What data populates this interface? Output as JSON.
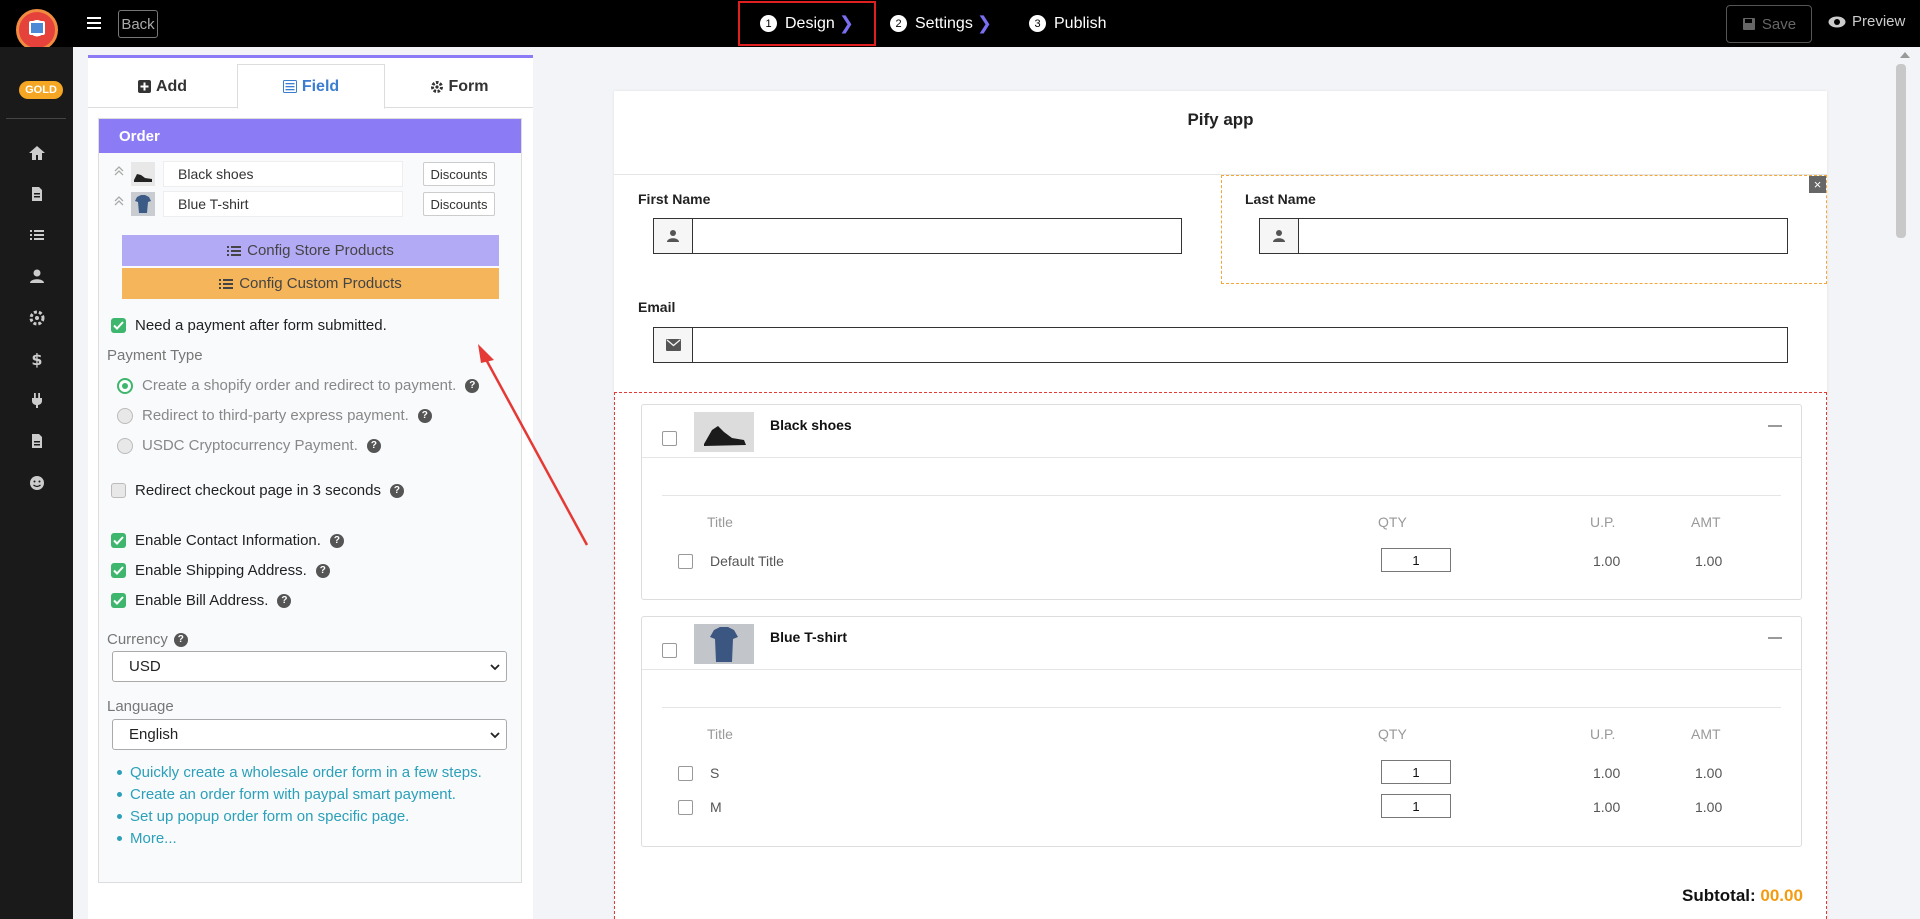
{
  "topbar": {
    "back_label": "Back",
    "steps": [
      {
        "num": "1",
        "label": "Design"
      },
      {
        "num": "2",
        "label": "Settings"
      },
      {
        "num": "3",
        "label": "Publish"
      }
    ],
    "save_label": "Save",
    "preview_label": "Preview"
  },
  "leftnav": {
    "badge": "GOLD",
    "icons": [
      "home-icon",
      "file-icon",
      "list-icon",
      "user-icon",
      "gear-icon",
      "dollar-icon",
      "plug-icon",
      "document-icon",
      "smile-icon"
    ]
  },
  "panel": {
    "tabs": [
      {
        "label": "Add",
        "icon": "plus-square-icon"
      },
      {
        "label": "Field",
        "icon": "list-alt-icon"
      },
      {
        "label": "Form",
        "icon": "gear-icon"
      }
    ],
    "section_title": "Order",
    "products": [
      {
        "name": "Black shoes",
        "button": "Discounts"
      },
      {
        "name": "Blue T-shirt",
        "button": "Discounts"
      }
    ],
    "config_store_label": "Config Store Products",
    "config_custom_label": "Config Custom Products",
    "need_payment_label": "Need a payment after form submitted.",
    "payment_type_label": "Payment Type",
    "payment_options": [
      {
        "label": "Create a shopify order and redirect to payment.",
        "selected": true
      },
      {
        "label": "Redirect to third-party express payment.",
        "selected": false
      },
      {
        "label": "USDC Cryptocurrency Payment.",
        "selected": false
      }
    ],
    "redirect_label": "Redirect checkout page in 3 seconds",
    "enable_contact_label": "Enable Contact Information.",
    "enable_shipping_label": "Enable Shipping Address.",
    "enable_bill_label": "Enable Bill Address.",
    "currency_label": "Currency",
    "currency_value": "USD",
    "language_label": "Language",
    "language_value": "English",
    "links": [
      "Quickly create a wholesale order form in a few steps.",
      "Create an order form with paypal smart payment.",
      "Set up popup order form on specific page.",
      "More..."
    ]
  },
  "canvas": {
    "title": "Pify app",
    "first_name_label": "First Name",
    "last_name_label": "Last Name",
    "email_label": "Email",
    "table_headers": {
      "title": "Title",
      "qty": "QTY",
      "up": "U.P.",
      "amt": "AMT"
    },
    "product_cards": [
      {
        "name": "Black shoes",
        "variants": [
          {
            "title": "Default Title",
            "qty": "1",
            "up": "1.00",
            "amt": "1.00"
          }
        ]
      },
      {
        "name": "Blue T-shirt",
        "variants": [
          {
            "title": "S",
            "qty": "1",
            "up": "1.00",
            "amt": "1.00"
          },
          {
            "title": "M",
            "qty": "1",
            "up": "1.00",
            "amt": "1.00"
          }
        ]
      }
    ],
    "subtotal_label": "Subtotal:",
    "subtotal_value": "00.00"
  },
  "colors": {
    "accent_purple": "#8b7cf6",
    "config_store_bg": "#b3aaf5",
    "config_custom_bg": "#f5b55a",
    "check_green": "#3fb66d",
    "link_teal": "#2ba0b8",
    "subtotal_orange": "#f39c12",
    "active_step_border": "#e02020"
  }
}
